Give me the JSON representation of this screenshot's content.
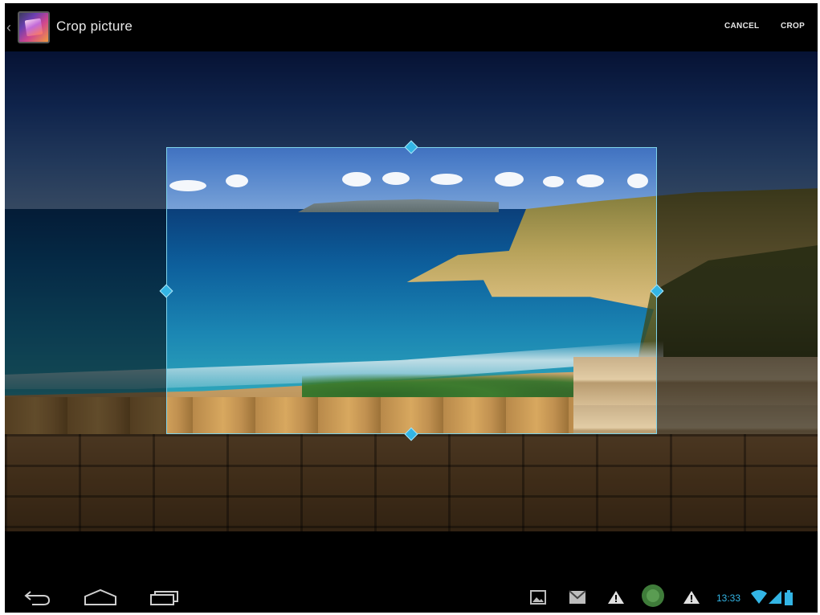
{
  "action_bar": {
    "title": "Crop picture",
    "app_icon": "gallery-icon",
    "cancel_label": "CANCEL",
    "crop_label": "CROP",
    "up_icon": "chevron-left-icon"
  },
  "photo": {
    "description_icon": "photo"
  },
  "crop_selection": {
    "handles": [
      "top",
      "left",
      "right",
      "bottom"
    ],
    "accent_color": "#33b5e5"
  },
  "navigation": {
    "back_icon": "back-icon",
    "home_icon": "home-icon",
    "recents_icon": "recent-apps-icon"
  },
  "status_bar": {
    "notifications": [
      "gallery-icon",
      "email-icon",
      "warning-icon",
      "app-icon",
      "warning-icon"
    ],
    "time": "13:33",
    "wifi_icon": "wifi-icon",
    "signal_icon": "signal-icon",
    "battery_icon": "battery-icon"
  }
}
